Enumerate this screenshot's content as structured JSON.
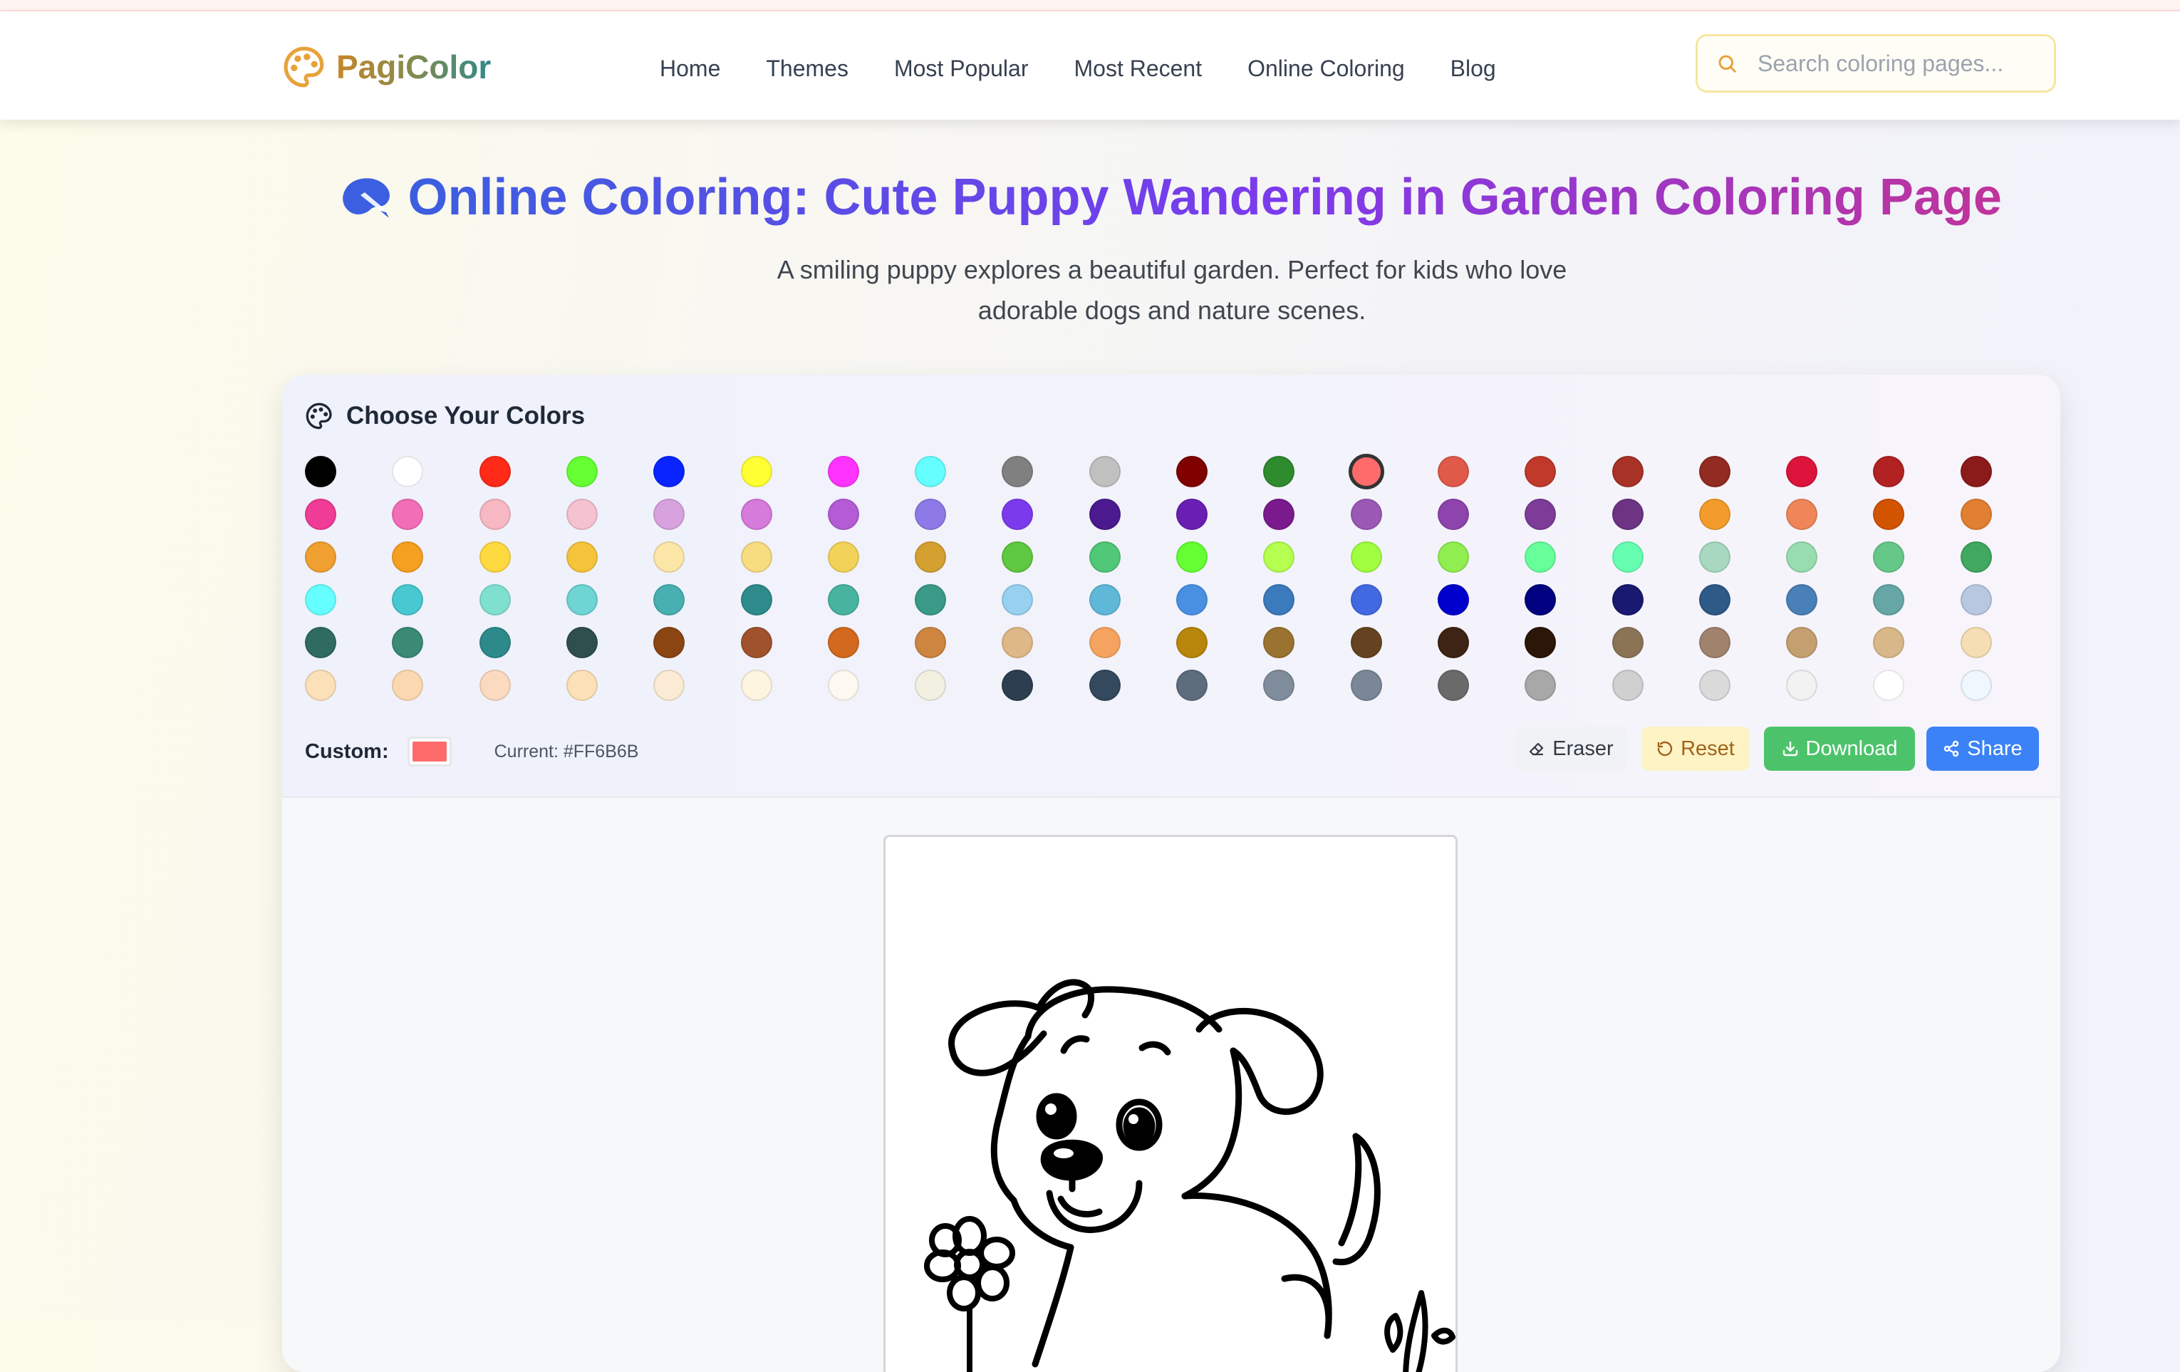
{
  "header": {
    "logo_text": "PagiColor",
    "nav": [
      "Home",
      "Themes",
      "Most Popular",
      "Most Recent",
      "Online Coloring",
      "Blog"
    ],
    "search_placeholder": "Search coloring pages..."
  },
  "page": {
    "title": "Online Coloring: Cute Puppy Wandering in Garden Coloring Page",
    "subtitle_line1": "A smiling puppy explores a beautiful garden. Perfect for kids who love",
    "subtitle_line2": "adorable dogs and nature scenes."
  },
  "toolbar": {
    "heading": "Choose Your Colors",
    "custom_label": "Custom:",
    "current_text": "Current: #FF6B6B",
    "selected_color": "#FF6B6B",
    "eraser_label": "Eraser",
    "reset_label": "Reset",
    "download_label": "Download",
    "share_label": "Share"
  },
  "palette": [
    [
      "#000000",
      "#FFFFFF",
      "#FF2A17",
      "#66FF33",
      "#0A24FF",
      "#FFFF33",
      "#FF33FF",
      "#66FFFF",
      "#808080",
      "#C0C0C0",
      "#800000",
      "#2E8B2E",
      "#FF6B6B",
      "#E05A4A",
      "#C0392B",
      "#A93226",
      "#922B21",
      "#DC143C",
      "#B22222",
      "#8B1A1A"
    ],
    [
      "#F03C96",
      "#F26EB7",
      "#F7B8C3",
      "#F5C2D0",
      "#D8A2DE",
      "#D67ADB",
      "#B45CD6",
      "#8E7AE6",
      "#7C3AED",
      "#4B1A8F",
      "#6A1FB3",
      "#7B1A8C",
      "#9B59B6",
      "#8E44AD",
      "#7D3C98",
      "#6C3483",
      "#F39C2B",
      "#F0855A",
      "#D35400",
      "#E08030"
    ],
    [
      "#F0A030",
      "#F5A020",
      "#FFD940",
      "#F5C43A",
      "#FCE6A8",
      "#F7DD80",
      "#F2D35A",
      "#D4A030",
      "#5EC840",
      "#50C878",
      "#66FF33",
      "#B4FF50",
      "#A0FF40",
      "#90EE50",
      "#66FF99",
      "#66FFB2",
      "#A8D8C0",
      "#98DDB0",
      "#66C888",
      "#40A860"
    ],
    [
      "#66FFFF",
      "#48C8D0",
      "#80E0D0",
      "#6ED4D4",
      "#48B0B0",
      "#2E8B8B",
      "#48B4A0",
      "#3A9A88",
      "#98D0F0",
      "#60B8D8",
      "#4A90E2",
      "#3A7ABD",
      "#4169E1",
      "#0000CD",
      "#000080",
      "#191970",
      "#2E5A88",
      "#4A80B8",
      "#66A6A6",
      "#B8C8E0"
    ],
    [
      "#2F6B5E",
      "#3A8A75",
      "#2E8A8A",
      "#2F4F4F",
      "#8B4513",
      "#A0522D",
      "#D2691E",
      "#CD853F",
      "#DEB887",
      "#F4A460",
      "#B8860B",
      "#9A7330",
      "#654321",
      "#3D2414",
      "#2B1608",
      "#8B7355",
      "#A0826D",
      "#C4A070",
      "#D8B888",
      "#F5DEB3"
    ],
    [
      "#FCE0B8",
      "#FCD8B0",
      "#FCDAC0",
      "#FCE0B8",
      "#FCEBD4",
      "#FDF5E0",
      "#FDF8F0",
      "#F2F0E0",
      "#2C3E50",
      "#34495E",
      "#5D6D7E",
      "#7F8C9B",
      "#7A8796",
      "#6A6A6A",
      "#A8A8A8",
      "#D0D0D0",
      "#DADADA",
      "#F2F2F2",
      "#FFFFFF",
      "#F0F8FF"
    ]
  ],
  "icons": {
    "logo": "palette-icon",
    "search": "search-icon",
    "title": "brush-icon",
    "heading": "palette-outline-icon",
    "eraser": "eraser-icon",
    "reset": "rotate-ccw-icon",
    "download": "download-icon",
    "share": "share-icon"
  },
  "colors": {
    "selected_ring": "#333333",
    "download_bg": "#4CC36A",
    "share_bg": "#3B82F6",
    "reset_bg": "#FDF3C4"
  }
}
